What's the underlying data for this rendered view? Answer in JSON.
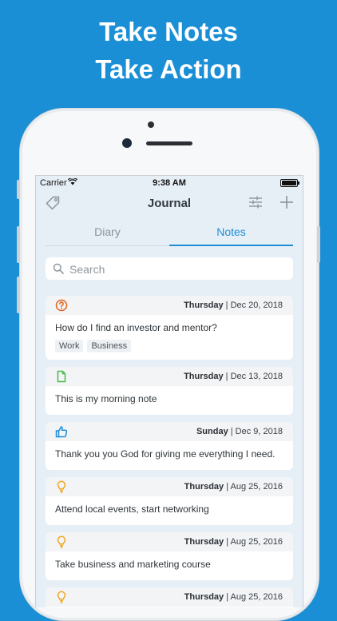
{
  "headline": {
    "line1": "Take Notes",
    "line2": "Take Action"
  },
  "status_bar": {
    "carrier": "Carrier",
    "time": "9:38 AM"
  },
  "nav": {
    "title": "Journal"
  },
  "tabs": [
    {
      "label": "Diary",
      "active": false
    },
    {
      "label": "Notes",
      "active": true
    }
  ],
  "search": {
    "placeholder": "Search",
    "value": ""
  },
  "notes": [
    {
      "icon": "question-circle-icon",
      "icon_color": "#e2621b",
      "day": "Thursday",
      "date": "Dec 20, 2018",
      "text": "How do I find an investor and mentor?",
      "tags": [
        "Work",
        "Business"
      ]
    },
    {
      "icon": "document-icon",
      "icon_color": "#4cb84f",
      "day": "Thursday",
      "date": "Dec 13, 2018",
      "text": "This is my morning note",
      "tags": []
    },
    {
      "icon": "thumbs-up-icon",
      "icon_color": "#1a8fd6",
      "day": "Sunday",
      "date": "Dec 9, 2018",
      "text": "Thank you you God for giving me everything I need.",
      "tags": []
    },
    {
      "icon": "lightbulb-icon",
      "icon_color": "#f3a51b",
      "day": "Thursday",
      "date": "Aug 25, 2016",
      "text": "Attend local events, start networking",
      "tags": []
    },
    {
      "icon": "lightbulb-icon",
      "icon_color": "#f3a51b",
      "day": "Thursday",
      "date": "Aug 25, 2016",
      "text": "Take business and marketing course",
      "tags": []
    },
    {
      "icon": "lightbulb-icon",
      "icon_color": "#f3a51b",
      "day": "Thursday",
      "date": "Aug 25, 2016",
      "text": "",
      "tags": []
    }
  ],
  "colors": {
    "background": "#1a8fd6",
    "accent": "#1a8fd6",
    "screen": "#e7eff6"
  }
}
